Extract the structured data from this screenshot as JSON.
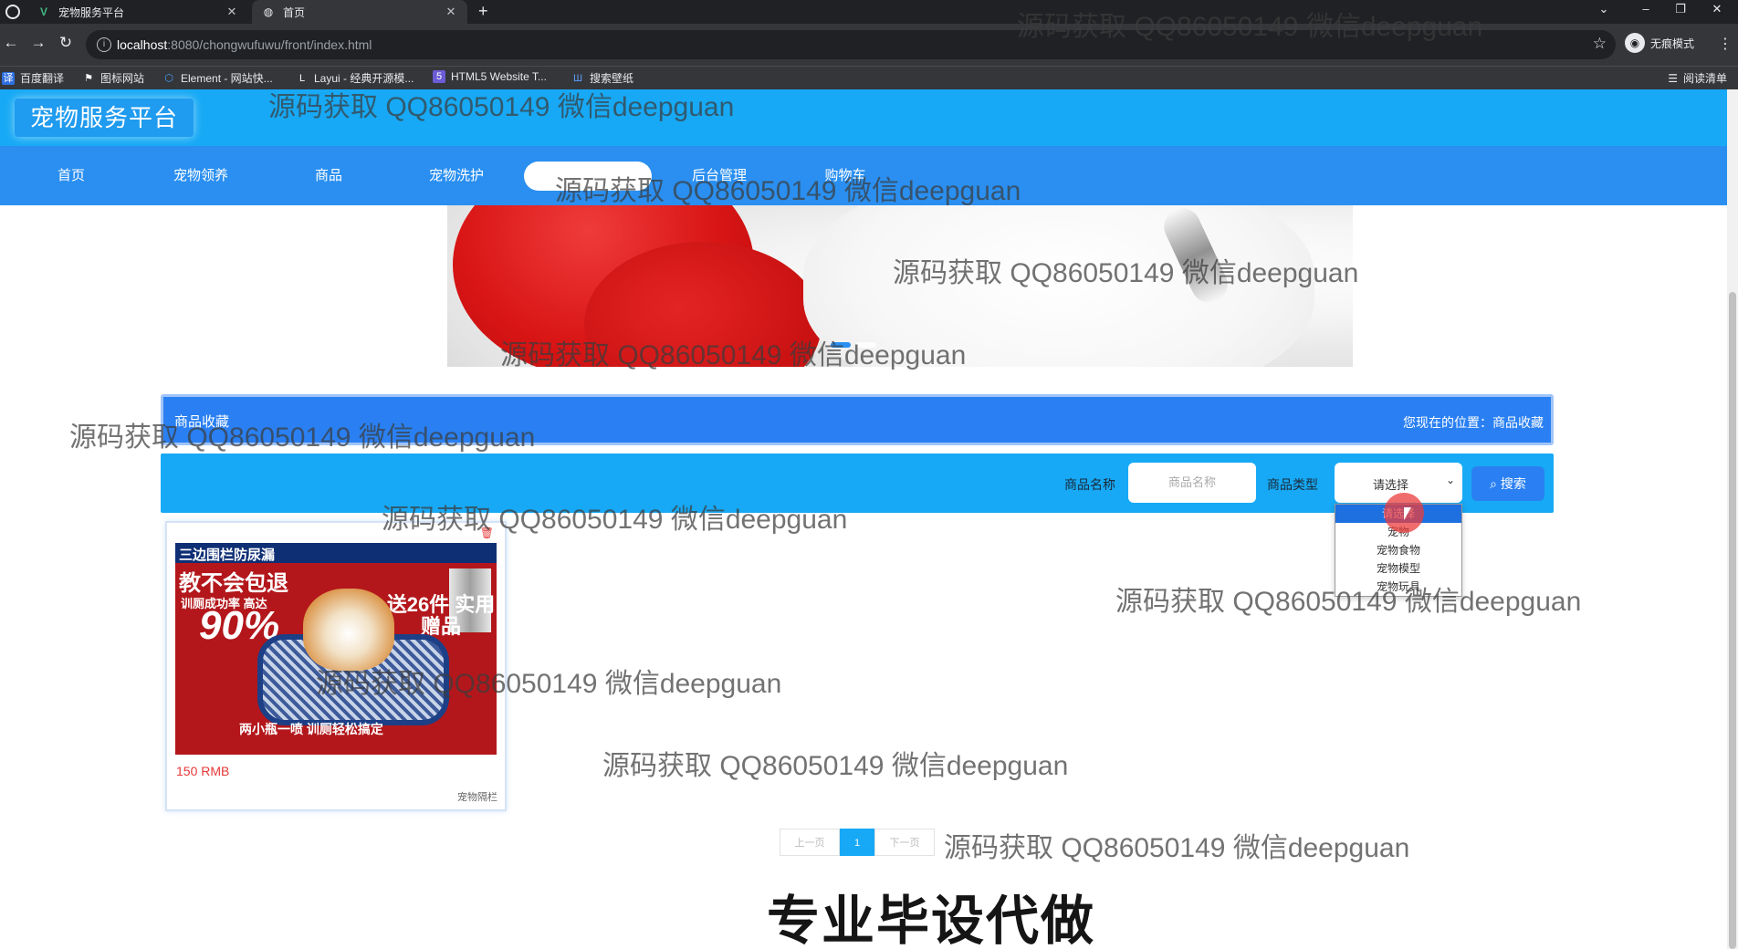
{
  "browser": {
    "tabs": [
      {
        "title": "宠物服务平台",
        "icon": "vue-icon"
      },
      {
        "title": "首页",
        "icon": "globe-icon"
      }
    ],
    "url_host": "localhost",
    "url_path": ":8080/chongwufuwu/front/index.html",
    "profile_label": "无痕模式",
    "reading_list": "阅读清单",
    "bookmarks": [
      "百度翻译",
      "图标网站",
      "Element - 网站快...",
      "Layui - 经典开源模...",
      "HTML5 Website T...",
      "搜索壁纸"
    ]
  },
  "site": {
    "logo": "宠物服务平台",
    "nav": [
      "首页",
      "宠物领养",
      "商品",
      "宠物洗护",
      "",
      "后台管理",
      "购物车"
    ]
  },
  "breadcrumb": {
    "title": "商品收藏",
    "location_label": "您现在的位置：",
    "location_value": "商品收藏"
  },
  "search": {
    "name_label": "商品名称",
    "name_placeholder": "商品名称",
    "type_label": "商品类型",
    "type_selected": "请选择",
    "type_options": [
      "请选择",
      "宠物",
      "宠物食物",
      "宠物模型",
      "宠物玩具"
    ],
    "button": "搜索"
  },
  "products": [
    {
      "price": "150 RMB",
      "type": "宠物隔栏",
      "image_text": {
        "line1": "三边围栏防尿漏",
        "line2": "教不会包退",
        "rate_label": "训厕成功率 高达",
        "rate": "90%",
        "gift": "送26件 实用赠品",
        "bottom": "两小瓶一喷 训厕轻松搞定"
      }
    }
  ],
  "pagination": {
    "prev": "上一页",
    "current": "1",
    "next": "下一页"
  },
  "promo": "专业毕设代做",
  "watermark": "源码获取 QQ86050149 微信deepguan",
  "colors": {
    "header": "#17a9f5",
    "nav": "#2a8ff0",
    "breadcrumb": "#2a80f2",
    "price": "#e63838"
  }
}
